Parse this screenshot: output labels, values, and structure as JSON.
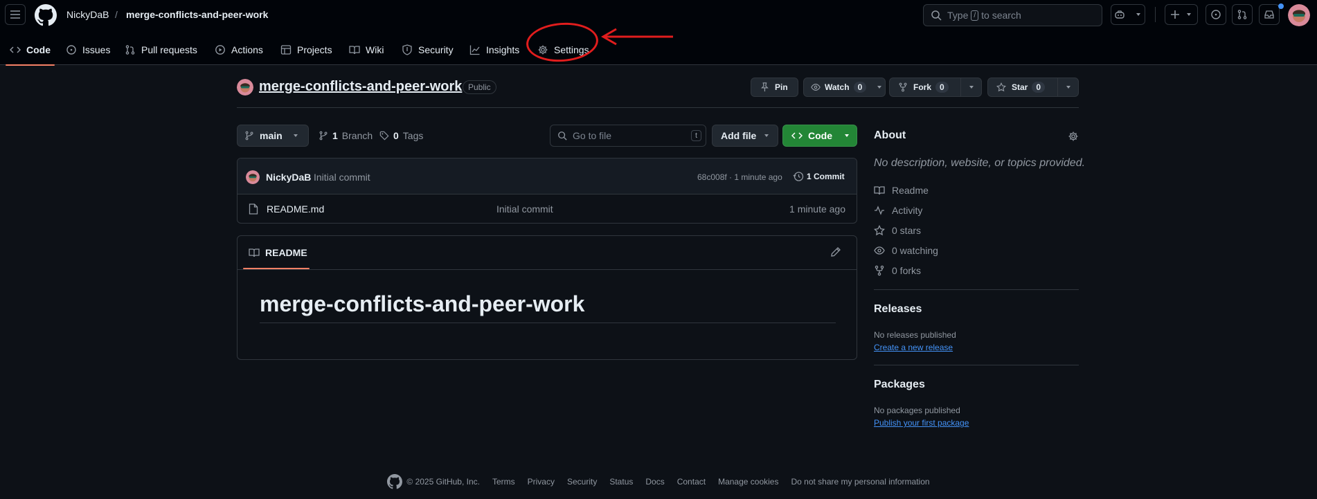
{
  "header": {
    "owner": "NickyDaB",
    "separator": "/",
    "repo": "merge-conflicts-and-peer-work",
    "search": {
      "prefix": "Type",
      "key": "/",
      "suffix": "to search"
    }
  },
  "tabs": [
    {
      "label": "Code",
      "icon": "code-icon",
      "active": true
    },
    {
      "label": "Issues",
      "icon": "issue-opened-icon"
    },
    {
      "label": "Pull requests",
      "icon": "git-pull-request-icon"
    },
    {
      "label": "Actions",
      "icon": "play-icon"
    },
    {
      "label": "Projects",
      "icon": "table-icon"
    },
    {
      "label": "Wiki",
      "icon": "book-icon"
    },
    {
      "label": "Security",
      "icon": "shield-icon"
    },
    {
      "label": "Insights",
      "icon": "graph-icon"
    },
    {
      "label": "Settings",
      "icon": "gear-icon"
    }
  ],
  "annotation": {
    "color": "#e11d1d",
    "target": "Settings"
  },
  "repo_header": {
    "name": "merge-conflicts-and-peer-work",
    "visibility": "Public",
    "pin": "Pin",
    "watch": "Watch",
    "watch_count": "0",
    "fork": "Fork",
    "fork_count": "0",
    "star": "Star",
    "star_count": "0"
  },
  "toolbar": {
    "branch": "main",
    "branches_count": "1",
    "branches_label": "Branch",
    "tags_count": "0",
    "tags_label": "Tags",
    "goto_placeholder": "Go to file",
    "goto_key": "t",
    "add_file": "Add file",
    "code": "Code"
  },
  "latest_commit": {
    "author": "NickyDaB",
    "message": "Initial commit",
    "hash_time": "68c008f · 1 minute ago",
    "commits_label": "1 Commit"
  },
  "files": [
    {
      "name": "README.md",
      "message": "Initial commit",
      "time": "1 minute ago"
    }
  ],
  "readme": {
    "tab": "README",
    "heading": "merge-conflicts-and-peer-work"
  },
  "about": {
    "title": "About",
    "description": "No description, website, or topics provided.",
    "items": [
      "Readme",
      "Activity",
      "0 stars",
      "0 watching",
      "0 forks"
    ]
  },
  "releases": {
    "title": "Releases",
    "empty": "No releases published",
    "link": "Create a new release"
  },
  "packages": {
    "title": "Packages",
    "empty": "No packages published",
    "link": "Publish your first package"
  },
  "footer": {
    "copyright": "© 2025 GitHub, Inc.",
    "links": [
      "Terms",
      "Privacy",
      "Security",
      "Status",
      "Docs",
      "Contact",
      "Manage cookies",
      "Do not share my personal information"
    ]
  },
  "colors": {
    "accent_underline": "#f78166",
    "code_button": "#238636",
    "link": "#4493f8",
    "background": "#0d1117"
  }
}
